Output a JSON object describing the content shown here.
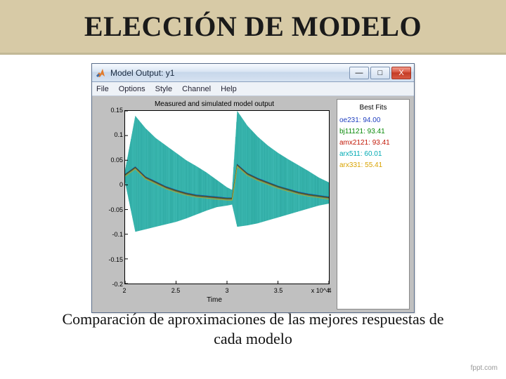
{
  "slide": {
    "title": "ELECCIÓN DE MODELO",
    "caption_l1": "Comparación de aproximaciones de las mejores respuestas de",
    "caption_l2": "cada modelo",
    "credit": "fppt.com"
  },
  "window": {
    "title": "Model Output: y1",
    "minimize_glyph": "—",
    "maximize_glyph": "□",
    "close_glyph": "X"
  },
  "menubar": [
    "File",
    "Options",
    "Style",
    "Channel",
    "Help"
  ],
  "chart_data": {
    "type": "line",
    "title": "Measured and simulated model output",
    "xlabel": "Time",
    "x_exponent": "x 10^4",
    "xlim": [
      2,
      4
    ],
    "ylim": [
      -0.2,
      0.15
    ],
    "xticks": [
      2,
      2.5,
      3,
      3.5,
      4
    ],
    "yticks": [
      -0.2,
      -0.15,
      -0.1,
      -0.05,
      0,
      0.05,
      0.1,
      0.15
    ],
    "legend_title": "Best Fits",
    "legend": [
      {
        "name": "oe231: 94.00",
        "color": "#1f3fbf"
      },
      {
        "name": "bj11121: 93.41",
        "color": "#0a8a0a"
      },
      {
        "name": "amx2121: 93.41",
        "color": "#c21807"
      },
      {
        "name": "arx511: 60.01",
        "color": "#00aab3"
      },
      {
        "name": "arx331: 55.41",
        "color": "#d9a300"
      }
    ],
    "envelope": [
      {
        "x": 2.0,
        "hi": 0.03,
        "mid": 0.02,
        "lo": 0.005
      },
      {
        "x": 2.1,
        "hi": 0.14,
        "mid": 0.035,
        "lo": -0.095
      },
      {
        "x": 2.2,
        "hi": 0.115,
        "mid": 0.015,
        "lo": -0.09
      },
      {
        "x": 2.3,
        "hi": 0.095,
        "mid": 0.005,
        "lo": -0.085
      },
      {
        "x": 2.4,
        "hi": 0.08,
        "mid": -0.005,
        "lo": -0.08
      },
      {
        "x": 2.5,
        "hi": 0.065,
        "mid": -0.012,
        "lo": -0.075
      },
      {
        "x": 2.6,
        "hi": 0.05,
        "mid": -0.018,
        "lo": -0.068
      },
      {
        "x": 2.7,
        "hi": 0.038,
        "mid": -0.022,
        "lo": -0.06
      },
      {
        "x": 2.8,
        "hi": 0.025,
        "mid": -0.024,
        "lo": -0.052
      },
      {
        "x": 2.9,
        "hi": 0.01,
        "mid": -0.026,
        "lo": -0.045
      },
      {
        "x": 3.0,
        "hi": -0.005,
        "mid": -0.028,
        "lo": -0.042
      },
      {
        "x": 3.05,
        "hi": -0.01,
        "mid": -0.028,
        "lo": -0.04
      },
      {
        "x": 3.1,
        "hi": 0.15,
        "mid": 0.04,
        "lo": -0.085
      },
      {
        "x": 3.2,
        "hi": 0.12,
        "mid": 0.022,
        "lo": -0.082
      },
      {
        "x": 3.3,
        "hi": 0.098,
        "mid": 0.012,
        "lo": -0.078
      },
      {
        "x": 3.4,
        "hi": 0.08,
        "mid": 0.004,
        "lo": -0.072
      },
      {
        "x": 3.5,
        "hi": 0.065,
        "mid": -0.004,
        "lo": -0.066
      },
      {
        "x": 3.6,
        "hi": 0.052,
        "mid": -0.01,
        "lo": -0.06
      },
      {
        "x": 3.7,
        "hi": 0.04,
        "mid": -0.016,
        "lo": -0.054
      },
      {
        "x": 3.8,
        "hi": 0.028,
        "mid": -0.02,
        "lo": -0.048
      },
      {
        "x": 3.9,
        "hi": 0.015,
        "mid": -0.023,
        "lo": -0.042
      },
      {
        "x": 4.0,
        "hi": 0.005,
        "mid": -0.026,
        "lo": -0.038
      }
    ]
  }
}
